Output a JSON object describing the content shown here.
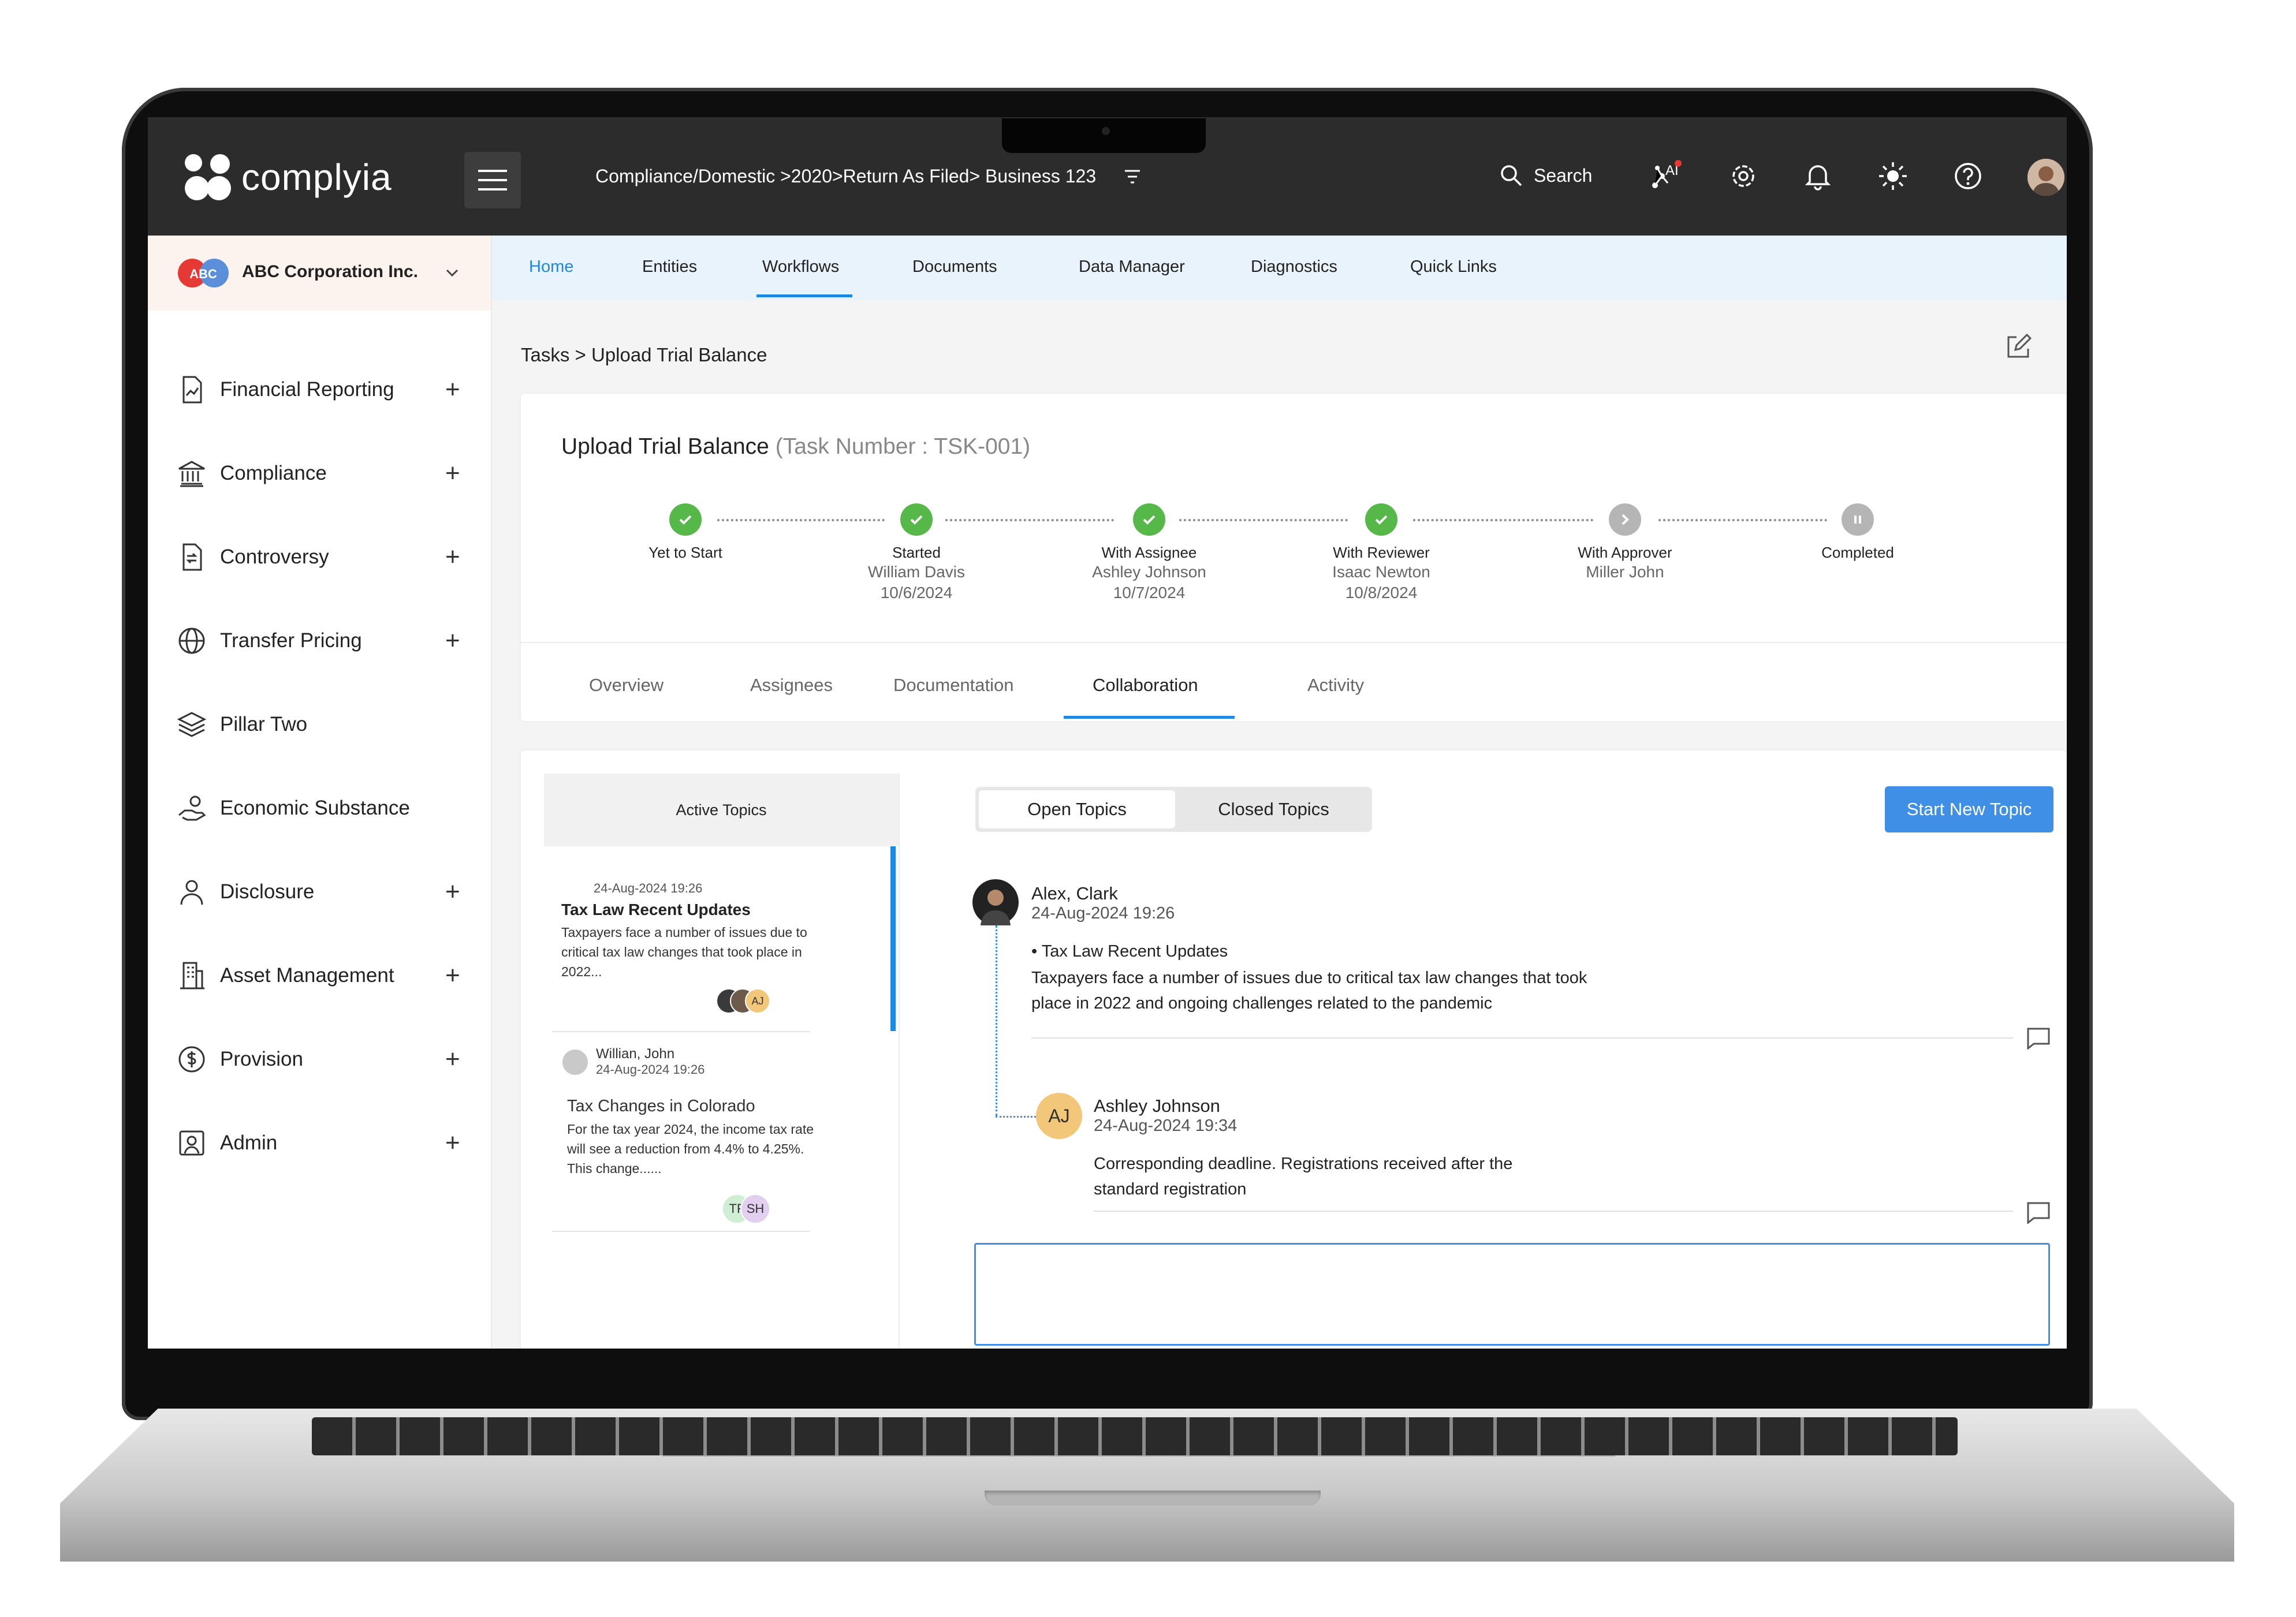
{
  "app": {
    "name": "complyia"
  },
  "topbar": {
    "breadcrumb": "Compliance/Domestic >2020>Return As Filed> Business 123",
    "search_label": "Search",
    "ai_label": "AI"
  },
  "org": {
    "logo_text": "ABC",
    "name": "ABC Corporation Inc."
  },
  "sidebar": {
    "items": [
      {
        "label": "Financial Reporting",
        "icon": "chart-doc-icon",
        "expand": "+"
      },
      {
        "label": "Compliance",
        "icon": "bank-icon",
        "expand": "+"
      },
      {
        "label": "Controversy",
        "icon": "doc-arrows-icon",
        "expand": "+"
      },
      {
        "label": "Transfer Pricing",
        "icon": "globe-icon",
        "expand": "+"
      },
      {
        "label": "Pillar Two",
        "icon": "layers-icon",
        "expand": ""
      },
      {
        "label": "Economic Substance",
        "icon": "hand-coin-icon",
        "expand": ""
      },
      {
        "label": "Disclosure",
        "icon": "user-icon",
        "expand": "+"
      },
      {
        "label": "Asset Management",
        "icon": "building-icon",
        "expand": "+"
      },
      {
        "label": "Provision",
        "icon": "dollar-circle-icon",
        "expand": "+"
      },
      {
        "label": "Admin",
        "icon": "admin-icon",
        "expand": "+"
      }
    ]
  },
  "nav": {
    "tabs": [
      "Home",
      "Entities",
      "Workflows",
      "Documents",
      "Data Manager",
      "Diagnostics",
      "Quick Links"
    ],
    "active": "Home",
    "selected": "Workflows"
  },
  "page": {
    "breadcrumb": "Tasks > Upload Trial Balance"
  },
  "task": {
    "title": "Upload Trial Balance",
    "number": "(Task Number : TSK-001)",
    "stages": [
      {
        "name": "Yet to Start",
        "who": "",
        "date": "",
        "status": "done"
      },
      {
        "name": "Started",
        "who": "William Davis",
        "date": "10/6/2024",
        "status": "done"
      },
      {
        "name": "With Assignee",
        "who": "Ashley Johnson",
        "date": "10/7/2024",
        "status": "done"
      },
      {
        "name": "With Reviewer",
        "who": "Isaac Newton",
        "date": "10/8/2024",
        "status": "done"
      },
      {
        "name": "With Approver",
        "who": "Miller John",
        "date": "",
        "status": "current"
      },
      {
        "name": "Completed",
        "who": "",
        "date": "",
        "status": "paused"
      }
    ],
    "tabs": [
      "Overview",
      "Assignees",
      "Documentation",
      "Collaboration",
      "Activity"
    ],
    "active_tab": "Collaboration"
  },
  "topics": {
    "header": "Active Topics",
    "items": [
      {
        "date": "24-Aug-2024 19:26",
        "title": "Tax Law Recent Updates",
        "desc": "Taxpayers face a number of issues due to critical tax law changes that took place in 2022...",
        "avatar_initials": "AJ"
      },
      {
        "author": "Willian, John",
        "date": "24-Aug-2024 19:26",
        "title": "Tax Changes in Colorado",
        "desc": "For the tax year 2024, the income tax rate will see a reduction from 4.4% to 4.25%. This change......",
        "avatars": [
          "TF",
          "SH"
        ]
      }
    ]
  },
  "collab": {
    "open_label": "Open Topics",
    "closed_label": "Closed Topics",
    "start_label": "Start New Topic",
    "messages": [
      {
        "author": "Alex, Clark",
        "date": "24-Aug-2024  19:26",
        "topic": "Tax Law Recent Updates",
        "text1": "Taxpayers face a number of issues due to critical tax law changes that took",
        "text2": "place in 2022 and ongoing challenges related to the pandemic"
      },
      {
        "author": "Ashley Johnson",
        "initials": "AJ",
        "date": "24-Aug-2024  19:34",
        "text1": "Corresponding deadline. Registrations received after the",
        "text2": "standard registration"
      }
    ]
  },
  "colors": {
    "accent": "#1e88e5",
    "button": "#3f8fe6",
    "success": "#55b848",
    "pending": "#b5b5b5",
    "topbar": "#2c2c2c"
  }
}
